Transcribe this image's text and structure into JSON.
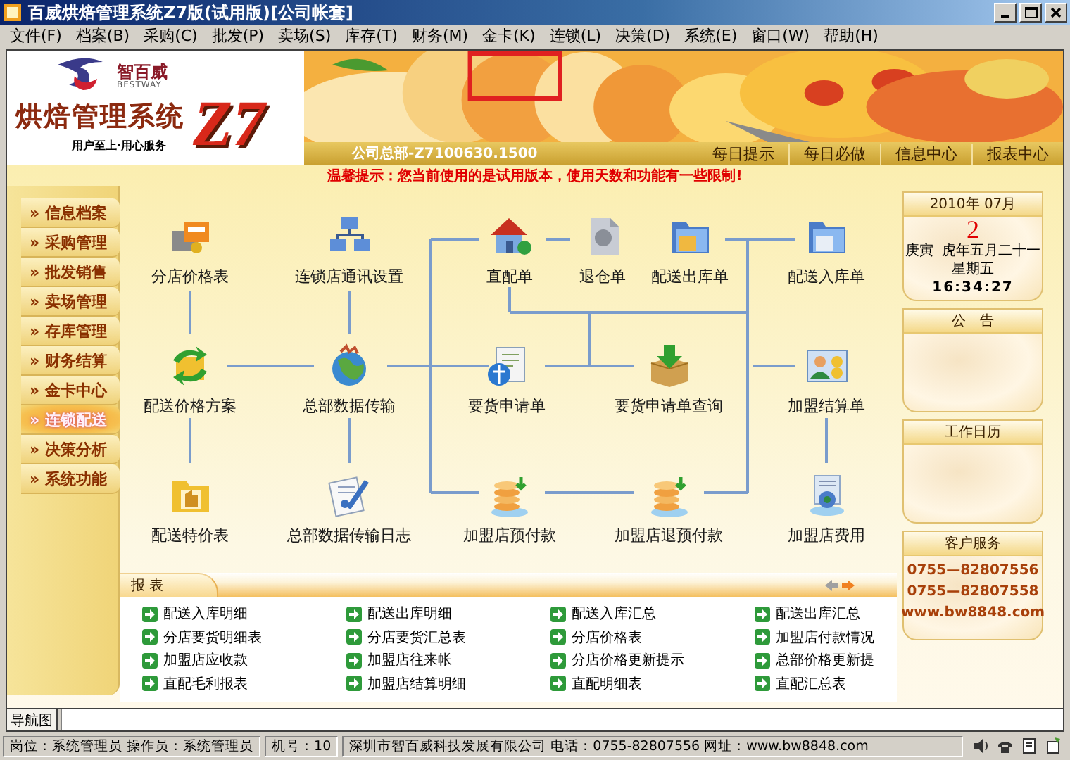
{
  "window": {
    "title": "百威烘焙管理系统Z7版(试用版)[公司帐套]"
  },
  "menu": [
    "文件(F)",
    "档案(B)",
    "采购(C)",
    "批发(P)",
    "卖场(S)",
    "库存(T)",
    "财务(M)",
    "金卡(K)",
    "连锁(L)",
    "决策(D)",
    "系统(E)",
    "窗口(W)",
    "帮助(H)"
  ],
  "banner": {
    "brand": "智百威",
    "brand_en": "BESTWAY",
    "product": "烘焙管理系统",
    "version_mark": "Z7",
    "slogan": "用户至上·用心服务",
    "company": "公司总部-Z7100630.1500"
  },
  "nav_links": [
    "每日提示",
    "每日必做",
    "信息中心",
    "报表中心"
  ],
  "notice": "温馨提示：您当前使用的是试用版本，使用天数和功能有一些限制!",
  "sidebar": {
    "items": [
      {
        "label": "» 信息档案",
        "selected": false
      },
      {
        "label": "» 采购管理",
        "selected": false
      },
      {
        "label": "» 批发销售",
        "selected": false
      },
      {
        "label": "» 卖场管理",
        "selected": false
      },
      {
        "label": "» 存库管理",
        "selected": false
      },
      {
        "label": "» 财务结算",
        "selected": false
      },
      {
        "label": "» 金卡中心",
        "selected": false
      },
      {
        "label": "» 连锁配送",
        "selected": true
      },
      {
        "label": "» 决策分析",
        "selected": false
      },
      {
        "label": "» 系统功能",
        "selected": false
      }
    ]
  },
  "diagram": {
    "nodes": [
      {
        "label": "分店价格表"
      },
      {
        "label": "连锁店通讯设置"
      },
      {
        "label": "直配单"
      },
      {
        "label": "退仓单"
      },
      {
        "label": "配送出库单"
      },
      {
        "label": "配送入库单"
      },
      {
        "label": "配送价格方案"
      },
      {
        "label": "总部数据传输"
      },
      {
        "label": "要货申请单"
      },
      {
        "label": "要货申请单查询"
      },
      {
        "label": "加盟结算单"
      },
      {
        "label": "配送特价表"
      },
      {
        "label": "总部数据传输日志"
      },
      {
        "label": "加盟店预付款"
      },
      {
        "label": "加盟店退预付款"
      },
      {
        "label": "加盟店费用"
      }
    ]
  },
  "reports": {
    "title": "报 表",
    "items": [
      "配送入库明细",
      "配送出库明细",
      "配送入库汇总",
      "配送出库汇总",
      "分店要货明细表",
      "分店要货汇总表",
      "分店价格表",
      "加盟店付款情况",
      "加盟店应收款",
      "加盟店往来帐",
      "分店价格更新提示",
      "总部价格更新提",
      "直配毛利报表",
      "加盟店结算明细",
      "直配明细表",
      "直配汇总表"
    ]
  },
  "calendar": {
    "month": "2010年 07月",
    "day": "2",
    "lunar": "庚寅  虎年五月二十一",
    "weekday": "星期五",
    "time": "16:34:27"
  },
  "panels": [
    {
      "title": "公　告"
    },
    {
      "title": "工作日历"
    }
  ],
  "service": {
    "title": "客户服务",
    "lines": [
      "0755—82807556",
      "0755—82807558",
      "www.bw8848.com"
    ]
  },
  "bottom_tab": "导航图",
  "status_bar": [
    "岗位：系统管理员 操作员：系统管理员",
    "机号：10",
    "深圳市智百威科技发展有限公司 电话：0755-82807556 网址：www.bw8848.com"
  ]
}
